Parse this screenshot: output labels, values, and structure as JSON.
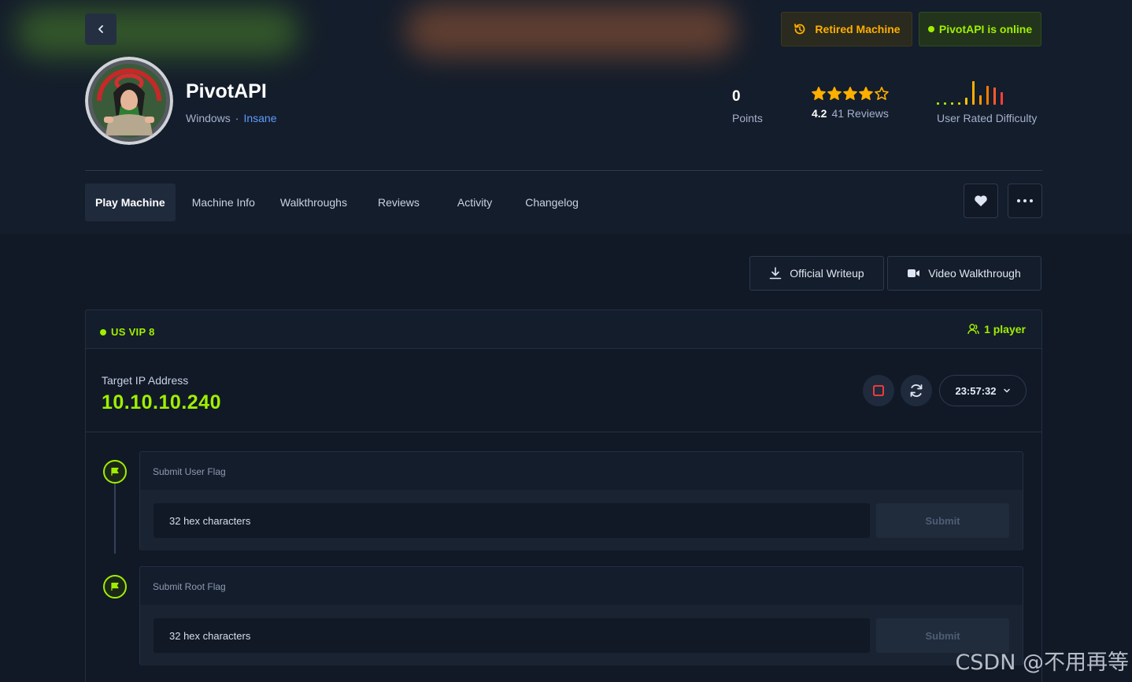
{
  "header": {
    "retired_label": "Retired Machine",
    "online_label": "PivotAPI is online"
  },
  "machine": {
    "name": "PivotAPI",
    "os": "Windows",
    "separator": "·",
    "difficulty": "Insane"
  },
  "stats": {
    "points_value": "0",
    "points_label": "Points",
    "rating_value": "4.2",
    "rating_fraction": 0.84,
    "reviews_label": "41 Reviews",
    "difficulty_label": "User Rated Difficulty"
  },
  "tabs": [
    {
      "label": "Play Machine",
      "active": true
    },
    {
      "label": "Machine Info",
      "active": false
    },
    {
      "label": "Walkthroughs",
      "active": false
    },
    {
      "label": "Reviews",
      "active": false
    },
    {
      "label": "Activity",
      "active": false
    },
    {
      "label": "Changelog",
      "active": false
    }
  ],
  "actions": {
    "writeup_label": "Official Writeup",
    "video_label": "Video Walkthrough"
  },
  "instance": {
    "server": "US VIP 8",
    "players": "1 player",
    "target_label": "Target IP Address",
    "target_ip": "10.10.10.240",
    "timer": "23:57:32"
  },
  "flags": [
    {
      "title": "Submit User Flag",
      "placeholder": "32 hex characters",
      "submit_label": "Submit"
    },
    {
      "title": "Submit Root Flag",
      "placeholder": "32 hex characters",
      "submit_label": "Submit"
    }
  ],
  "watermark": "CSDN @不用再等",
  "colors": {
    "accent_green": "#9fef00",
    "accent_orange": "#ffaf00",
    "accent_blue": "#5d9cff",
    "background": "#111927",
    "panel": "#141d2b"
  }
}
